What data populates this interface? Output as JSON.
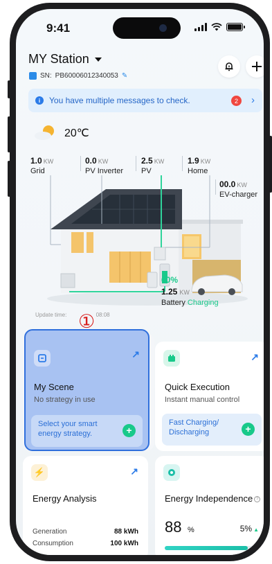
{
  "status_bar": {
    "time": "9:41"
  },
  "header": {
    "station_name": "MY Station",
    "sn_prefix": "SN:",
    "sn_value": "PB60006012340053"
  },
  "banner": {
    "message": "You have multiple messages to check.",
    "count": "2"
  },
  "weather": {
    "temperature": "20℃"
  },
  "flows": {
    "grid": {
      "value": "1.0",
      "unit": "KW",
      "label": "Grid"
    },
    "pv_inverter": {
      "value": "0.0",
      "unit": "KW",
      "label": "PV Inverter"
    },
    "pv": {
      "value": "2.5",
      "unit": "KW",
      "label": "PV"
    },
    "home": {
      "value": "1.9",
      "unit": "KW",
      "label": "Home"
    },
    "ev_charger": {
      "value": "00.0",
      "unit": "KW",
      "label": "EV-charger"
    }
  },
  "battery": {
    "percent": "60%",
    "power": "1.25",
    "unit": "KW",
    "label": "Battery",
    "status": "Charging"
  },
  "update_time": {
    "label": "Update time:",
    "value": "08:08"
  },
  "step_marker": "①",
  "cards": {
    "my_scene": {
      "title": "My Scene",
      "subtitle": "No strategy in use",
      "action_line1": "Select your smart",
      "action_line2": "energy strategy."
    },
    "quick_execution": {
      "title": "Quick Execution",
      "subtitle": "Instant manual control",
      "action_line1": "Fast Charging/",
      "action_line2": "Discharging"
    },
    "energy_analysis": {
      "title": "Energy Analysis",
      "rows": [
        {
          "label": "Generation",
          "value": "88 kWh"
        },
        {
          "label": "Consumption",
          "value": "100 kWh"
        }
      ]
    },
    "energy_independence": {
      "title": "Energy Independence",
      "value": "88",
      "unit": "%",
      "change": "5%",
      "progress": 0.88
    }
  },
  "colors": {
    "accent_green": "#18c98a",
    "accent_blue": "#2b7be8",
    "alert_red": "#f0473f",
    "highlight_blue": "#2f6fdc"
  }
}
